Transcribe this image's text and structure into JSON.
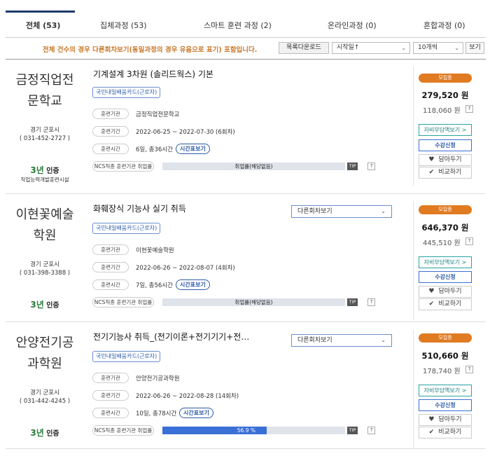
{
  "tabs": [
    {
      "label": "전체 (53)"
    },
    {
      "label": "집체과정 (53)"
    },
    {
      "label": "스마트 훈련 과정 (2)"
    },
    {
      "label": "온라인과정 (0)"
    },
    {
      "label": "혼합과정 (0)"
    }
  ],
  "notice": "전체 건수의 경우 다른회차보기(동일과정의 경우 유음으로 표기) 포함입니다.",
  "toolbar": {
    "download": "목록다운로드",
    "sort": "시작일↑",
    "count": "10개씩",
    "view": "보기"
  },
  "labels": {
    "institution": "훈련기관",
    "period": "훈련기간",
    "time": "훈련시간",
    "ncs": "NCS직종 훈련기관 취업률",
    "time_btn": "시간표보기",
    "tip": "TIP",
    "q": "?",
    "other_session": "다른회차보기",
    "self_pay": "자비부담액보기 >",
    "apply": "수강신청",
    "wish": "담아두기",
    "compare": "비교하기"
  },
  "colors": {
    "accent": "#2b5aa8",
    "status": "#e07b22",
    "notice": "#c9782a"
  },
  "courses": [
    {
      "inst_line1": "금정직업전",
      "inst_line2": "문학교",
      "addr1": "경기 군포시",
      "addr2": "( 031-452-2727 )",
      "cert_num": "3년",
      "cert_label": "인증",
      "cert_sub": "직업능력개발훈련시설",
      "title": "기계설계 3차원 (솔리드웍스) 기본",
      "tag": "국민내일배움카드(근로자)",
      "institution": "금정직업전문학교",
      "period": "2022-06-25 ~ 2022-07-30 (6회차)",
      "time": "6일, 총36시간",
      "ncs_text": "취업률(해당없음)",
      "ncs_rate": 0,
      "status": "모집중",
      "price": "279,520 원",
      "sub_price": "118,060 원"
    },
    {
      "inst_line1": "이현꽃예술",
      "inst_line2": "학원",
      "addr1": "경기 군포시",
      "addr2": "( 031-398-3388 )",
      "cert_num": "3년",
      "cert_label": "인증",
      "title": "화훼장식 기능사 실기 취득",
      "tag": "국민내일배움카드(근로자)",
      "institution": "이현꽃예술학원",
      "period": "2022-06-26 ~ 2022-08-07 (4회차)",
      "time": "7일, 총56시간",
      "ncs_text": "취업률(해당없음)",
      "ncs_rate": 0,
      "status": "모집중",
      "price": "646,370 원",
      "sub_price": "445,510 원"
    },
    {
      "inst_line1": "안양전기공",
      "inst_line2": "과학원",
      "addr1": "경기 군포시",
      "addr2": "( 031-442-4245 )",
      "cert_num": "3년",
      "cert_label": "인증",
      "title": "전기기능사 취득_(전기이론+전기기기+전…",
      "tag": "국민내일배움카드(근로자)",
      "institution": "안양전기공과학원",
      "period": "2022-06-26 ~ 2022-08-28 (14회차)",
      "time": "10일, 총78시간",
      "ncs_text": "56.9 %",
      "ncs_rate": 56.9,
      "status": "모집중",
      "price": "510,660 원",
      "sub_price": "178,740 원"
    }
  ]
}
